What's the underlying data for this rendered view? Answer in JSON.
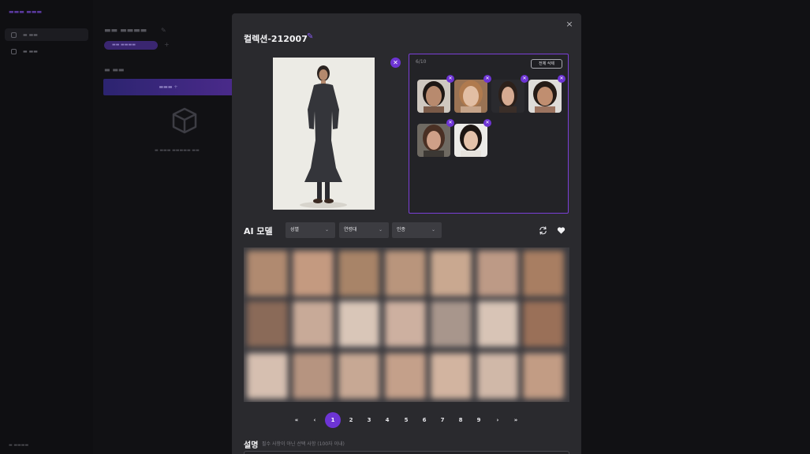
{
  "modal": {
    "title": "컬렉션-212007",
    "close_icon": "×",
    "selected": {
      "count": "6/10",
      "clear_all": "전체 삭제"
    },
    "ai_section": {
      "title": "AI 모델",
      "filters": [
        {
          "label": "성별"
        },
        {
          "label": "연령대"
        },
        {
          "label": "인종"
        }
      ]
    },
    "pagination": {
      "first": "«",
      "prev": "‹",
      "pages": [
        "1",
        "2",
        "3",
        "4",
        "5",
        "6",
        "7",
        "8",
        "9"
      ],
      "current": "1",
      "next": "›",
      "last": "»"
    },
    "description": {
      "title": "설명",
      "hint": "필수 사항이 아닌 선택 사항 (100자 이내)"
    }
  },
  "colors": {
    "accent": "#6d34d4",
    "panel": "#2a2a2e",
    "backdrop": "#111114"
  }
}
